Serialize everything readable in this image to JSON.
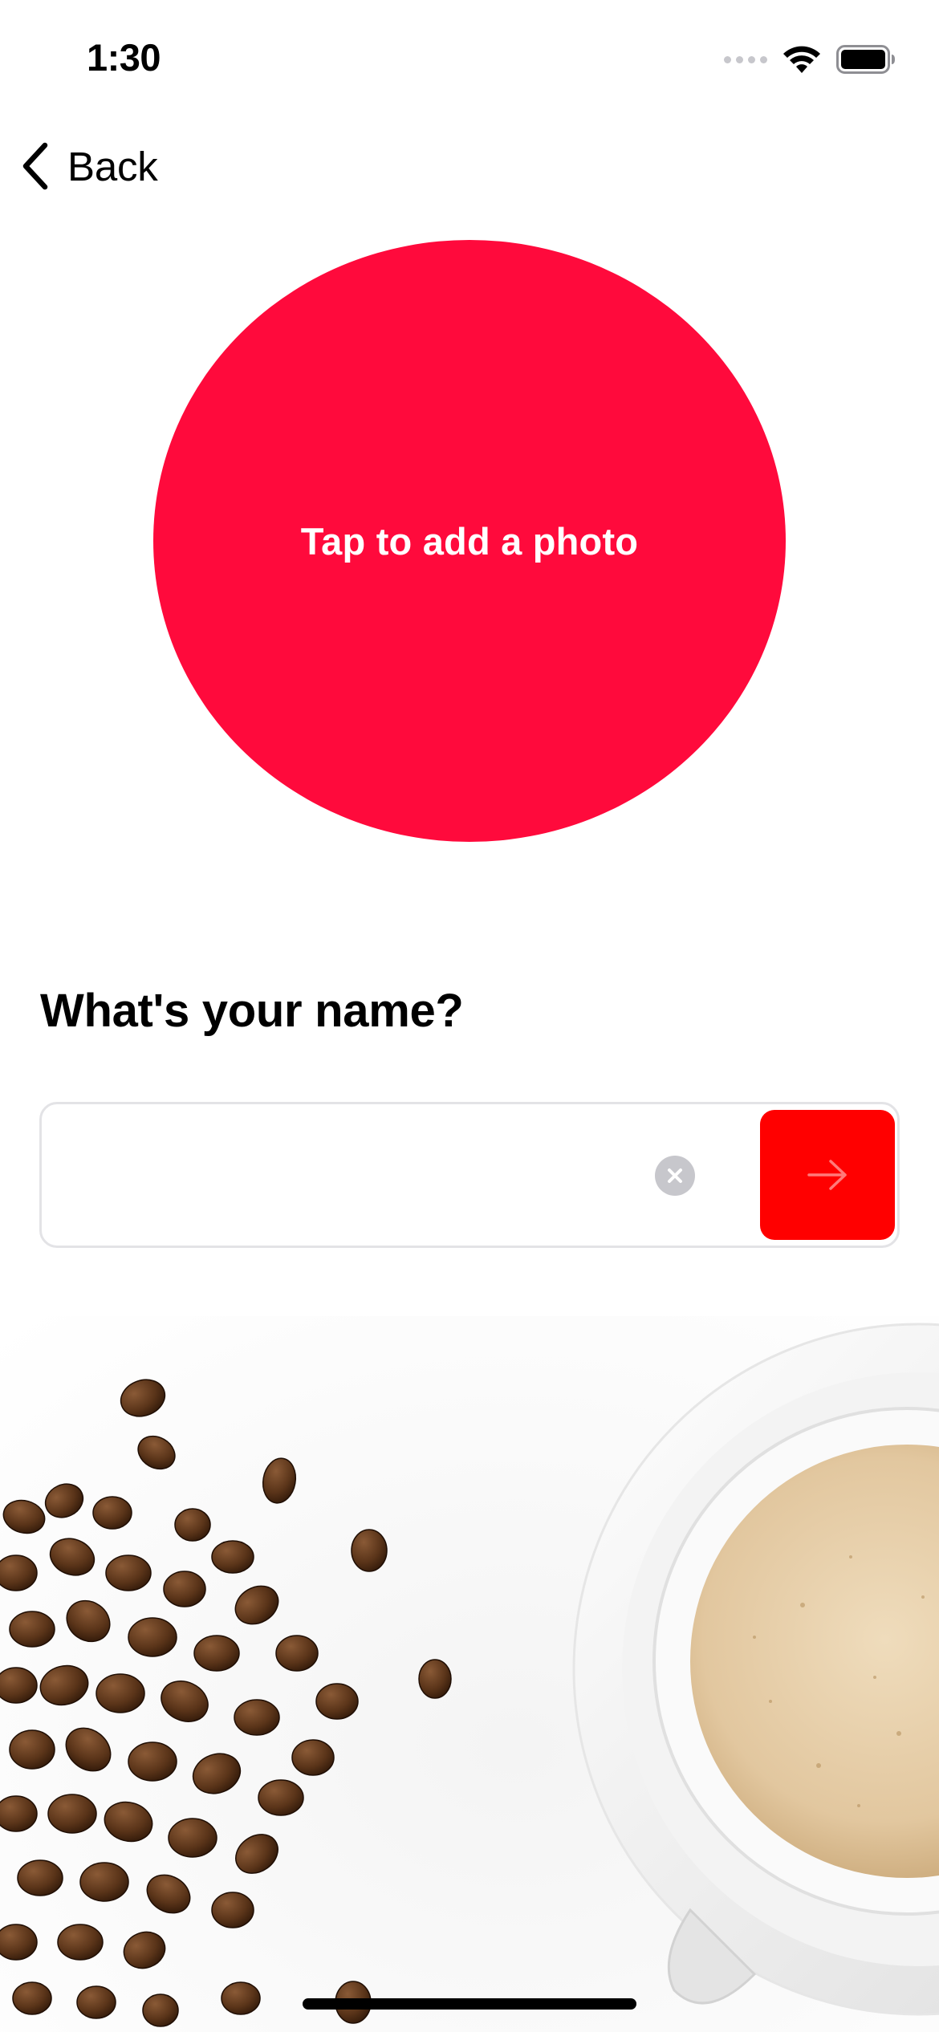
{
  "status_bar": {
    "time": "1:30",
    "icons": [
      "signal-icon",
      "wifi-icon",
      "battery-icon"
    ]
  },
  "navigation": {
    "back_label": "Back",
    "back_icon": "chevron-left-icon"
  },
  "photo_picker": {
    "label": "Tap to add a photo",
    "color": "#ff0a3c"
  },
  "name_prompt": {
    "title": "What's your name?"
  },
  "name_field": {
    "value": "",
    "placeholder": "",
    "clear_icon": "clear-circle-icon"
  },
  "submit": {
    "icon": "arrow-right-icon",
    "color": "#ff0000"
  },
  "decoration": {
    "subject": "coffee-beans-and-cup"
  },
  "colors": {
    "accent_red": "#ff0a3c",
    "button_red": "#ff0000",
    "field_border": "#e3e3e6"
  }
}
